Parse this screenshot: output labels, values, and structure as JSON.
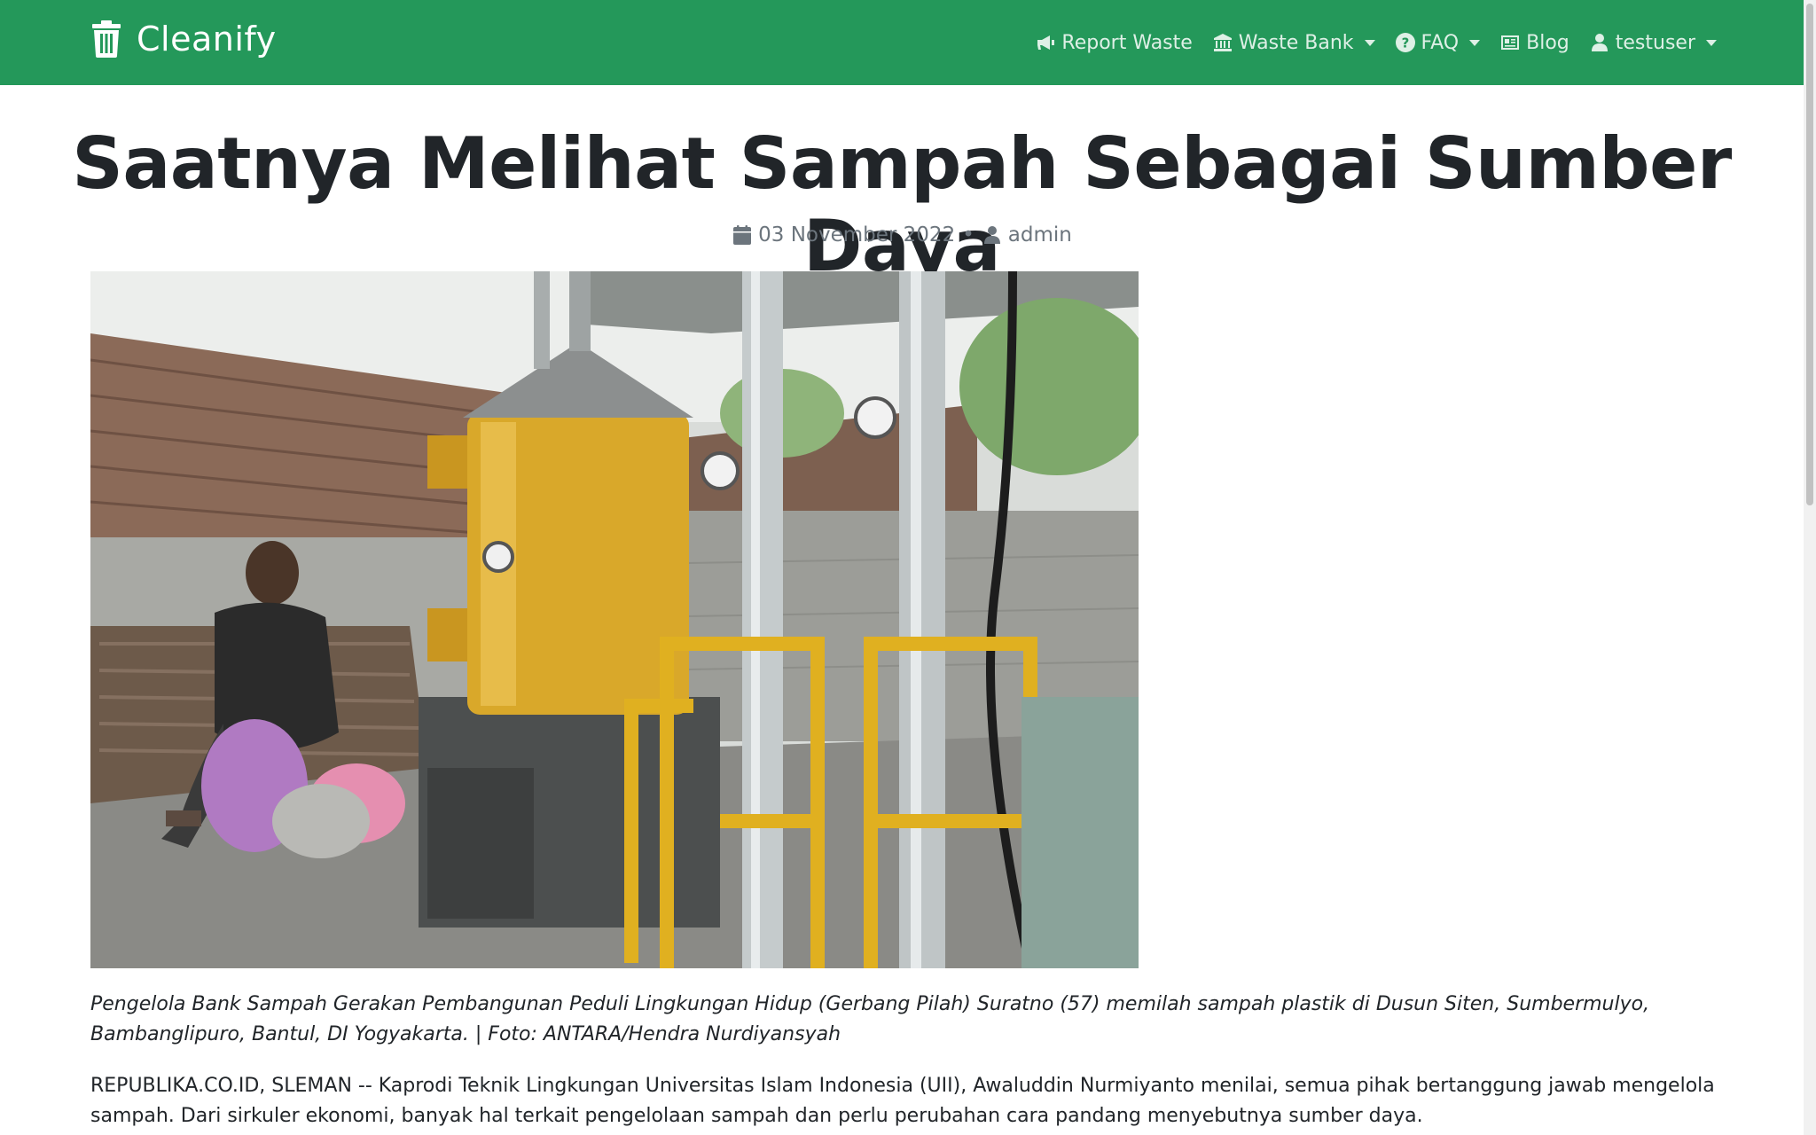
{
  "navbar": {
    "brand": "Cleanify",
    "items": [
      {
        "label": "Report Waste",
        "icon": "megaphone-icon",
        "dropdown": false
      },
      {
        "label": "Waste Bank",
        "icon": "bank-icon",
        "dropdown": true
      },
      {
        "label": "FAQ",
        "icon": "question-circle-icon",
        "dropdown": true
      },
      {
        "label": "Blog",
        "icon": "newspaper-icon",
        "dropdown": false
      },
      {
        "label": "testuser",
        "icon": "user-icon",
        "dropdown": true
      }
    ],
    "color": "#24985a"
  },
  "article": {
    "title": "Saatnya Melihat Sampah Sebagai Sumber Daya",
    "date": "03 November 2022",
    "separator": "•",
    "author": "admin",
    "caption": "Pengelola Bank Sampah Gerakan Pembangunan Peduli Lingkungan Hidup (Gerbang Pilah) Suratno (57) memilah sampah plastik di Dusun Siten, Sumbermulyo, Bambanglipuro, Bantul, DI Yogyakarta. | Foto: ANTARA/Hendra Nurdiyansyah",
    "body": "REPUBLIKA.CO.ID, SLEMAN -- Kaprodi Teknik Lingkungan Universitas Islam Indonesia (UII), Awaluddin Nurmiyanto menilai, semua pihak bertanggung jawab mengelola sampah. Dari sirkuler ekonomi, banyak hal terkait pengelolaan sampah dan perlu perubahan cara pandang menyebutnya sumber daya."
  }
}
